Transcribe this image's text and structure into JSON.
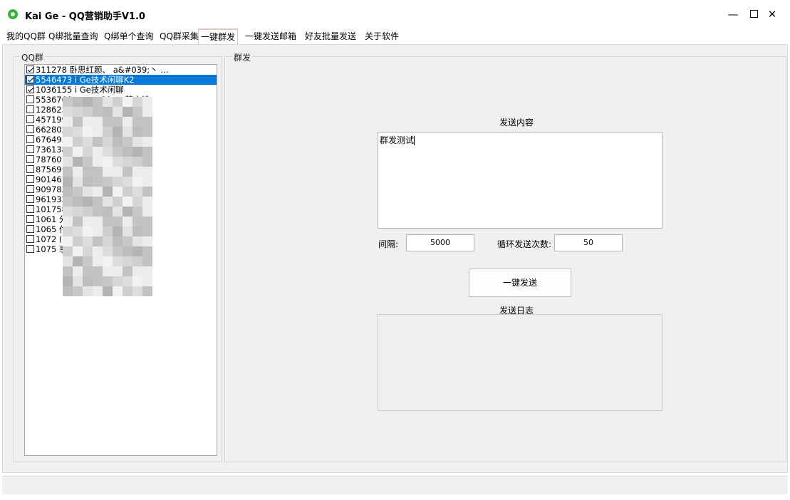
{
  "window": {
    "title": "Kai Ge - QQ营销助手V1.0",
    "controls": {
      "minimize": "—",
      "close": "✕"
    }
  },
  "tabs": [
    {
      "label": "我的QQ群"
    },
    {
      "label": "Q绑批量查询"
    },
    {
      "label": "Q绑单个查询"
    },
    {
      "label": "QQ群采集"
    },
    {
      "label": "一键群发",
      "active": true
    },
    {
      "label": "一键发送邮箱"
    },
    {
      "label": "好友批量发送"
    },
    {
      "label": "关于软件"
    }
  ],
  "left_group": {
    "legend": "QQ群",
    "items": [
      {
        "text": "311278   卧思红颜、  a&#039;丶 …",
        "checked": true
      },
      {
        "text": "5546473     i Ge技术闲聊K2",
        "checked": true,
        "selected": true
      },
      {
        "text": "1036155      i Ge技术闲聊",
        "checked": true
      },
      {
        "text": "5536760   . . . 、    39;丶 梦玄诗",
        "checked": false
      },
      {
        "text": "1286238      I官方    ①",
        "checked": false
      },
      {
        "text": "457199       商务报",
        "checked": false
      },
      {
        "text": "662802       7线排",
        "checked": false
      },
      {
        "text": "676493       深花",
        "checked": false
      },
      {
        "text": "736138       学    群",
        "checked": false
      },
      {
        "text": "787601       系",
        "checked": false
      },
      {
        "text": "875691       网     9群）",
        "checked": false
      },
      {
        "text": "901461       开发者④",
        "checked": false
      },
      {
        "text": "909783       铺    流群",
        "checked": false
      },
      {
        "text": "961932",
        "checked": false
      },
      {
        "text": "1017581         2",
        "checked": false
      },
      {
        "text": "1061          分享E5",
        "checked": false
      },
      {
        "text": "1065          付",
        "checked": false
      },
      {
        "text": "1072       (1）班网络上",
        "checked": false
      },
      {
        "text": "1075        享库D3",
        "checked": false
      }
    ]
  },
  "right_group": {
    "legend": "群发",
    "content_label": "发送内容",
    "content_value": "群发测试",
    "interval_label": "间隔:",
    "interval_value": "5000",
    "loop_label": "循环发送次数:",
    "loop_value": "50",
    "send_button": "一键发送",
    "log_label": "发送日志"
  },
  "colors": {
    "selection": "#0078d7",
    "panel_bg": "#f0f0f0",
    "accent_icon": "#3fae3f"
  }
}
